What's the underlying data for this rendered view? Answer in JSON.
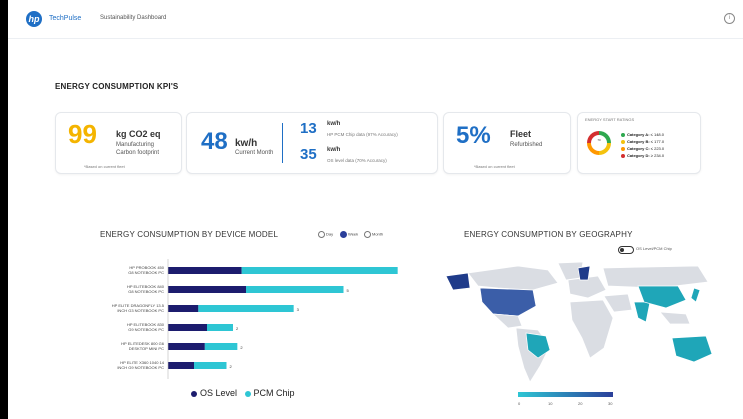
{
  "header": {
    "brand": "TechPulse",
    "subtitle": "Sustainability Dashboard",
    "logo_text": "hp"
  },
  "kpi_section_title": "ENERGY CONSUMPTION KPI'S",
  "kpis": {
    "carbon": {
      "value": "99",
      "unit": "kg CO2 eq",
      "line1": "Manufacturing",
      "line2": "Carbon footprint",
      "note": "*Based on current fleet"
    },
    "energy": {
      "value": "48",
      "unit": "kw/h",
      "sub": "Current Month",
      "pcm_value": "13",
      "pcm_unit": "kw/h",
      "pcm_label": "HP PCM Chip data (97% Accuracy)",
      "os_value": "35",
      "os_unit": "kw/h",
      "os_label": "OS level data (70% Accuracy)"
    },
    "fleet": {
      "value": "5%",
      "label": "Fleet",
      "sub": "Refurbished",
      "note": "*Based on current fleet"
    },
    "ratings": {
      "title": "ENERGY START RATINGS",
      "center": "70",
      "categories": [
        {
          "label": "Category A:",
          "value": "≤ 148.0",
          "color": "#2fa84f"
        },
        {
          "label": "Category B:",
          "value": "≤ 177.0",
          "color": "#f4c20d"
        },
        {
          "label": "Category C:",
          "value": "≤ 223.0",
          "color": "#ff9800"
        },
        {
          "label": "Category D:",
          "value": "≥ 234.0",
          "color": "#d32f2f"
        }
      ]
    }
  },
  "device_chart": {
    "title": "ENERGY CONSUMPTION BY DEVICE MODEL",
    "toggles": [
      {
        "label": "Day",
        "selected": false
      },
      {
        "label": "Week",
        "selected": true
      },
      {
        "label": "Month",
        "selected": false
      }
    ],
    "legend": [
      {
        "label": "OS Level",
        "color": "#1c1c6e"
      },
      {
        "label": "PCM Chip",
        "color": "#2ec6d4"
      }
    ]
  },
  "geo_chart": {
    "title": "ENERGY CONSUMPTION BY GEOGRAPHY",
    "toggle_label": "OS Level/PCM Chip",
    "scale_ticks": [
      "0",
      "10",
      "20",
      "30"
    ]
  },
  "chart_data": {
    "type": "bar",
    "orientation": "horizontal",
    "stacked": true,
    "categories": [
      "HP PROBOOK 450 G8 NOTEBOOK PC",
      "HP ELITEBOOK 840 G8 NOTEBOOK PC",
      "HP ELITE DRAGONFLY 13.5 INCH G3 NOTEBOOK PC",
      "HP ELITEBOOK 830 G9 NOTEBOOK PC",
      "HP ELITEDESK 800 G6 DESKTOP MINI PC",
      "HP ELITE X360 1040 14 INCH G9 NOTEBOOK PC"
    ],
    "series": [
      {
        "name": "OS Level",
        "values": [
          3.4,
          3.6,
          1.4,
          1.8,
          1.7,
          1.2
        ]
      },
      {
        "name": "PCM Chip",
        "values": [
          7.2,
          4.5,
          4.4,
          1.2,
          1.5,
          1.5
        ]
      }
    ],
    "value_labels": [
      "",
      "5",
      "3",
      "2",
      "2",
      "2"
    ],
    "xlim": [
      0,
      12
    ]
  }
}
